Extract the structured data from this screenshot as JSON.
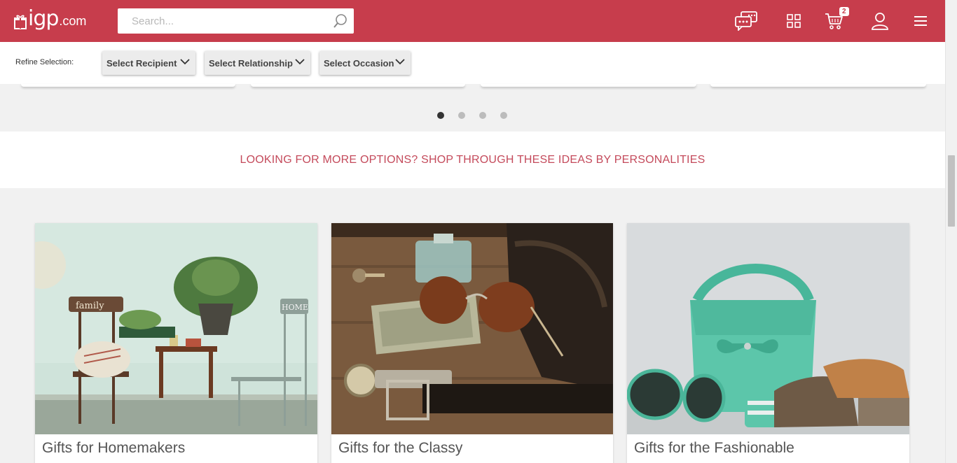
{
  "header": {
    "logo_text": "igp",
    "logo_tld": ".com",
    "search_placeholder": "Search...",
    "cart_count": "2"
  },
  "refine": {
    "label": "Refine Selection:",
    "dropdowns": [
      {
        "label": "Select Recipient"
      },
      {
        "label": "Select Relationship"
      },
      {
        "label": "Select Occasion"
      }
    ]
  },
  "carousel": {
    "page_count": 4,
    "active_index": 0
  },
  "banner": {
    "text": "LOOKING FOR MORE OPTIONS? SHOP THROUGH THESE IDEAS BY PERSONALITIES"
  },
  "personalities": [
    {
      "title": "Gifts for Homemakers",
      "image_text": "family",
      "image_text_2": "HOME"
    },
    {
      "title": "Gifts for the Classy"
    },
    {
      "title": "Gifts for the Fashionable"
    }
  ],
  "colors": {
    "brand": "#c73d4c",
    "banner_text": "#c44a5b"
  }
}
